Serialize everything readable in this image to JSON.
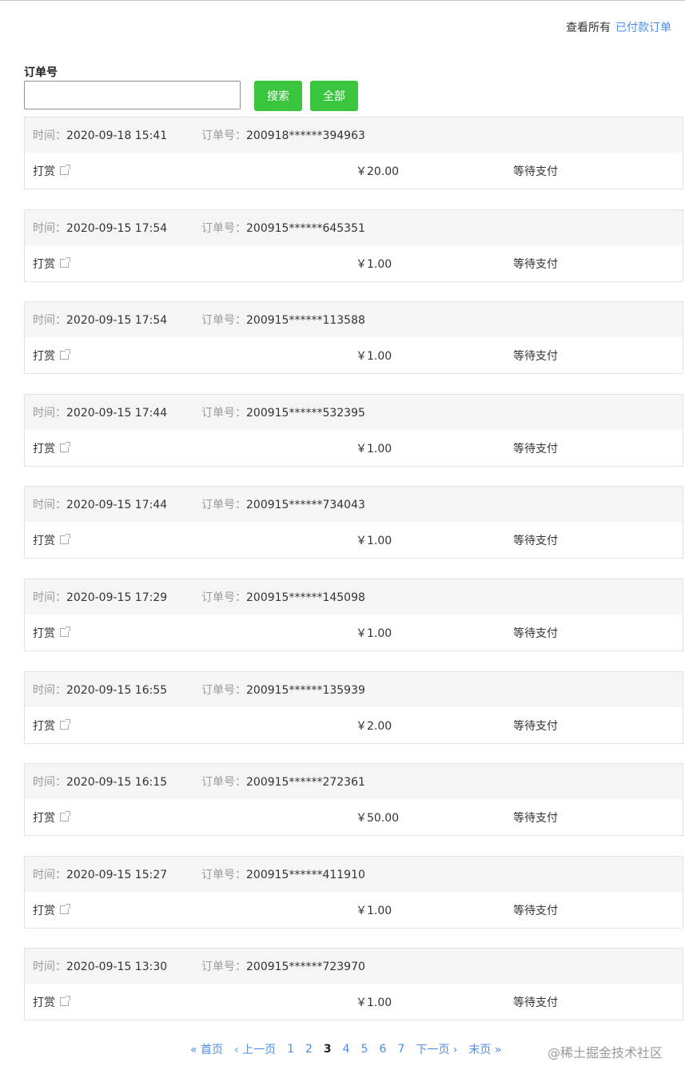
{
  "header": {
    "view_all_label": "查看所有",
    "paid_orders_link": "已付款订单"
  },
  "search": {
    "label": "订单号",
    "value": "",
    "placeholder": "",
    "search_button": "搜索",
    "all_button": "全部"
  },
  "labels": {
    "time": "时间：",
    "order_no": "订单号："
  },
  "orders": [
    {
      "time": "2020-09-18 15:41",
      "order_no": "200918******394963",
      "item": "打赏",
      "price": "￥20.00",
      "status": "等待支付"
    },
    {
      "time": "2020-09-15 17:54",
      "order_no": "200915******645351",
      "item": "打赏",
      "price": "￥1.00",
      "status": "等待支付"
    },
    {
      "time": "2020-09-15 17:54",
      "order_no": "200915******113588",
      "item": "打赏",
      "price": "￥1.00",
      "status": "等待支付"
    },
    {
      "time": "2020-09-15 17:44",
      "order_no": "200915******532395",
      "item": "打赏",
      "price": "￥1.00",
      "status": "等待支付"
    },
    {
      "time": "2020-09-15 17:44",
      "order_no": "200915******734043",
      "item": "打赏",
      "price": "￥1.00",
      "status": "等待支付"
    },
    {
      "time": "2020-09-15 17:29",
      "order_no": "200915******145098",
      "item": "打赏",
      "price": "￥1.00",
      "status": "等待支付"
    },
    {
      "time": "2020-09-15 16:55",
      "order_no": "200915******135939",
      "item": "打赏",
      "price": "￥2.00",
      "status": "等待支付"
    },
    {
      "time": "2020-09-15 16:15",
      "order_no": "200915******272361",
      "item": "打赏",
      "price": "￥50.00",
      "status": "等待支付"
    },
    {
      "time": "2020-09-15 15:27",
      "order_no": "200915******411910",
      "item": "打赏",
      "price": "￥1.00",
      "status": "等待支付"
    },
    {
      "time": "2020-09-15 13:30",
      "order_no": "200915******723970",
      "item": "打赏",
      "price": "￥1.00",
      "status": "等待支付"
    }
  ],
  "pagination": {
    "first": "« 首页",
    "prev": "‹ 上一页",
    "pages": [
      "1",
      "2",
      "3",
      "4",
      "5",
      "6",
      "7"
    ],
    "current": "3",
    "next": "下一页 ›",
    "last": "末页 »"
  },
  "watermark": "@稀土掘金技术社区",
  "icons": {
    "external_link": "external-link-icon"
  },
  "colors": {
    "accent_link": "#4a8ee8",
    "button_green": "#3ac53f",
    "header_bg": "#f5f5f5"
  }
}
